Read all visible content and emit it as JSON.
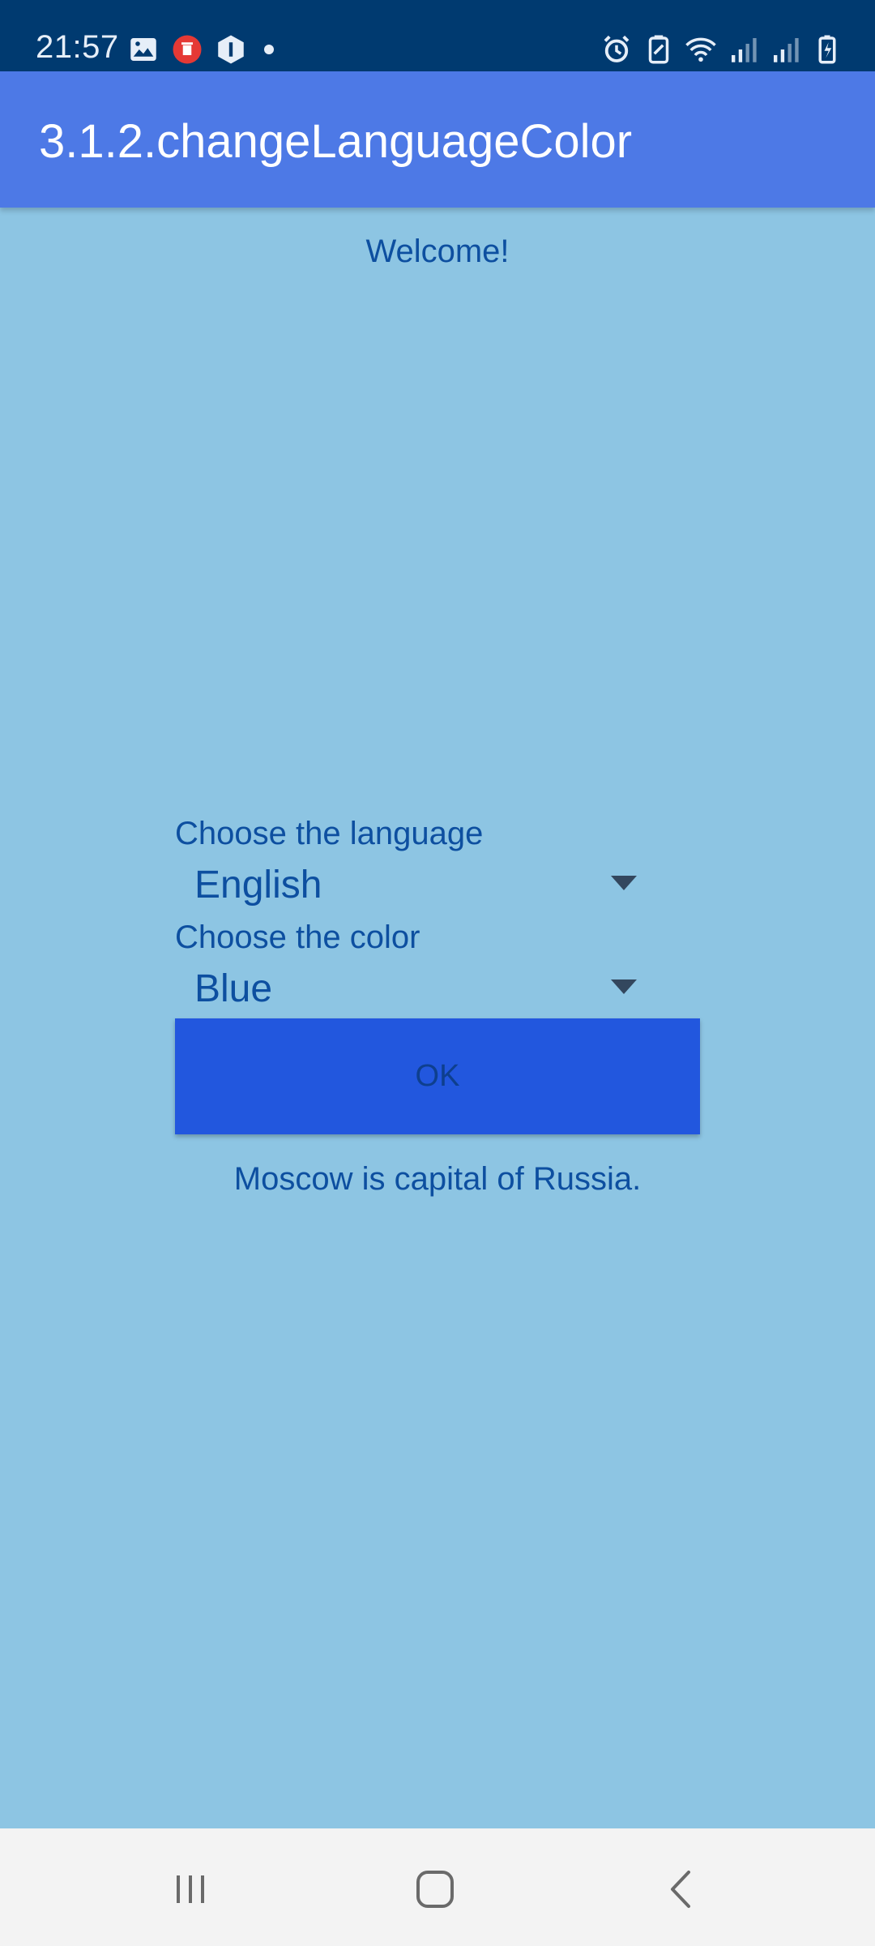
{
  "status_bar": {
    "time": "21:57",
    "left_icons": [
      "image-icon",
      "recorder-icon",
      "shield-icon",
      "notification-dot"
    ],
    "right_icons": [
      "alarm-icon",
      "battery-saver-icon",
      "wifi-icon",
      "signal-icon",
      "signal-icon-2",
      "battery-icon"
    ]
  },
  "app_bar": {
    "title": "3.1.2.changeLanguageColor"
  },
  "content": {
    "welcome": "Welcome!",
    "language_label": "Choose the language",
    "language_value": "English",
    "color_label": "Choose the color",
    "color_value": "Blue",
    "ok_label": "OK",
    "fact": "Moscow is capital of Russia."
  },
  "nav_bar": {
    "buttons": [
      "recent-apps-icon",
      "home-icon",
      "back-icon"
    ]
  },
  "colors": {
    "status_bar": "#003A70",
    "app_bar": "#4D79E6",
    "background": "#8DC5E3",
    "text": "#0D4FA0",
    "button": "#2257DE",
    "nav_bar": "#F3F3F3"
  }
}
